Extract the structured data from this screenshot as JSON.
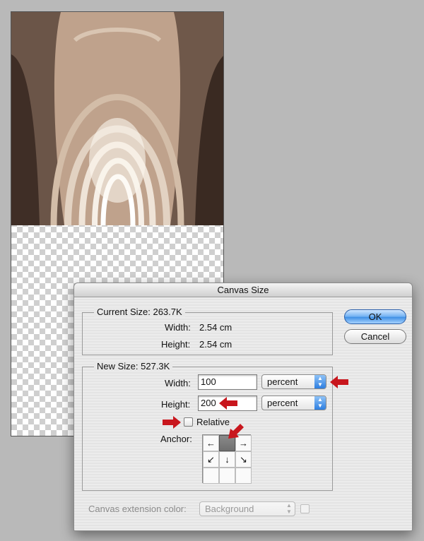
{
  "dialog": {
    "title": "Canvas Size",
    "current_size": {
      "label": "Current Size: 263.7K",
      "width_label": "Width:",
      "width_value": "2.54 cm",
      "height_label": "Height:",
      "height_value": "2.54 cm"
    },
    "new_size": {
      "label": "New Size: 527.3K",
      "width_label": "Width:",
      "width_value": "100",
      "width_unit": "percent",
      "height_label": "Height:",
      "height_value": "200",
      "height_unit": "percent",
      "relative_label": "Relative",
      "relative_checked": false,
      "anchor_label": "Anchor:",
      "anchor_selected": "top-center"
    },
    "extension_color": {
      "label": "Canvas extension color:",
      "value": "Background"
    },
    "buttons": {
      "ok": "OK",
      "cancel": "Cancel"
    }
  },
  "annotation_color": "#c8161d",
  "anchor_arrows": {
    "top-left": "←",
    "top-right": "→",
    "middle-left": "↙",
    "middle-center": "↓",
    "middle-right": "↘"
  }
}
